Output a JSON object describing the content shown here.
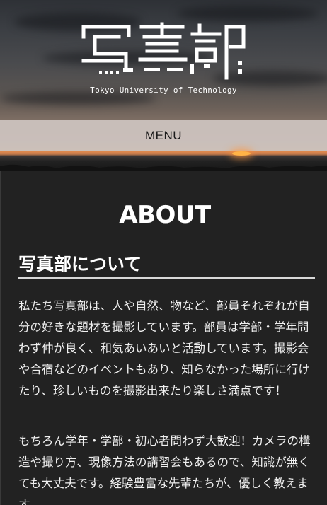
{
  "header": {
    "logo_text": "写真部",
    "logo_subtitle": "Tokyo University of Technology",
    "menu_label": "MENU"
  },
  "main": {
    "title": "ABOUT",
    "section_heading": "写真部について",
    "paragraphs": [
      "私たち写真部は、人や自然、物など、部員それぞれが自分の好きな題材を撮影しています。部員は学部・学年問わず仲が良く、和気あいあいと活動しています。撮影会や合宿などのイベントもあり、知らなかった場所に行けたり、珍しいものを撮影出来たり楽しさ満点です！",
      "もちろん学年・学部・初心者問わず大歓迎！カメラの構造や撮り方、現像方法の講習会もあるので、知識が無くても大丈夫です。経験豊富な先輩たちが、優しく教えます。"
    ]
  },
  "colors": {
    "background": "#222222",
    "text": "#ffffff",
    "menu_bar": "#cdc4bf"
  }
}
